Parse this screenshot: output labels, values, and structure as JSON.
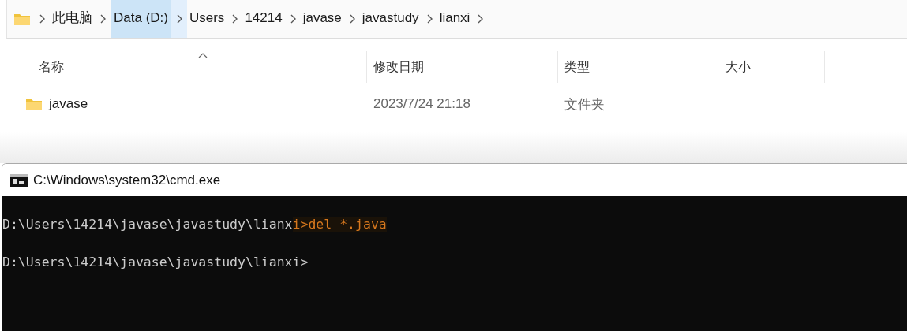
{
  "breadcrumb": [
    {
      "label": "此电脑",
      "selected": false
    },
    {
      "label": "Data (D:)",
      "selected": true
    },
    {
      "label": "Users",
      "selected": false
    },
    {
      "label": "14214",
      "selected": false
    },
    {
      "label": "javase",
      "selected": false
    },
    {
      "label": "javastudy",
      "selected": false
    },
    {
      "label": "lianxi",
      "selected": false
    }
  ],
  "table": {
    "columns": [
      {
        "label": "名称",
        "sorted": true
      },
      {
        "label": "修改日期",
        "sorted": false
      },
      {
        "label": "类型",
        "sorted": false
      },
      {
        "label": "大小",
        "sorted": false
      }
    ],
    "rows": [
      {
        "name": "javase",
        "modified": "2023/7/24 21:18",
        "type": "文件夹"
      }
    ]
  },
  "console": {
    "title": "C:\\Windows\\system32\\cmd.exe",
    "lines": [
      [
        {
          "text": "D:\\Users\\14214\\javase\\javastudy\\lianx",
          "highlighted": false
        },
        {
          "text": "i>del *.java",
          "highlighted": true
        }
      ],
      [
        {
          "text": "D:\\Users\\14214\\javase\\javastudy\\lianxi>",
          "highlighted": false
        }
      ]
    ]
  }
}
